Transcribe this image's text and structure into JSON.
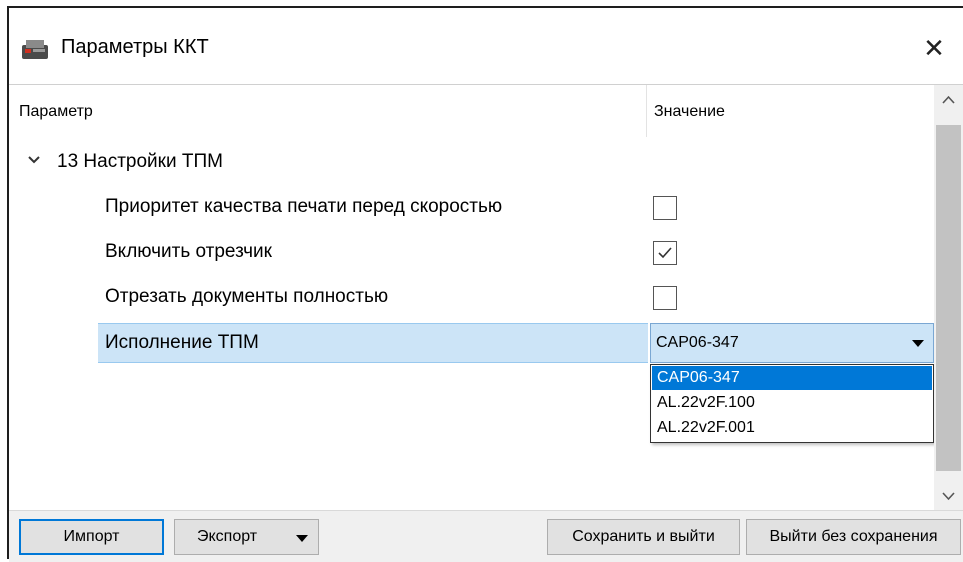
{
  "window": {
    "title": "Параметры ККТ",
    "close_glyph": "✕"
  },
  "table": {
    "header_param": "Параметр",
    "header_value": "Значение",
    "group": {
      "label": "13 Настройки ТПМ",
      "expanded": true
    },
    "rows": [
      {
        "label": "Приоритет качества печати перед скоростью",
        "type": "checkbox",
        "checked": false
      },
      {
        "label": "Включить отрезчик",
        "type": "checkbox",
        "checked": true
      },
      {
        "label": "Отрезать документы полностью",
        "type": "checkbox",
        "checked": false
      },
      {
        "label": "Исполнение ТПМ",
        "type": "combo",
        "value": "CAP06-347"
      }
    ],
    "dropdown_options": [
      "CAP06-347",
      "AL.22v2F.100",
      "AL.22v2F.001"
    ],
    "dropdown_selected": "CAP06-347"
  },
  "footer": {
    "import_label": "Импорт",
    "export_label": "Экспорт",
    "save_exit_label": "Сохранить и выйти",
    "exit_nosave_label": "Выйти без сохранения"
  },
  "colors": {
    "selection": "#cce4f7",
    "accent": "#0078d7"
  },
  "icons": [
    "printer-icon",
    "close-icon",
    "chevron-down-icon",
    "checkmark-icon",
    "dropdown-arrow-icon",
    "scroll-up-icon",
    "scroll-down-icon"
  ]
}
